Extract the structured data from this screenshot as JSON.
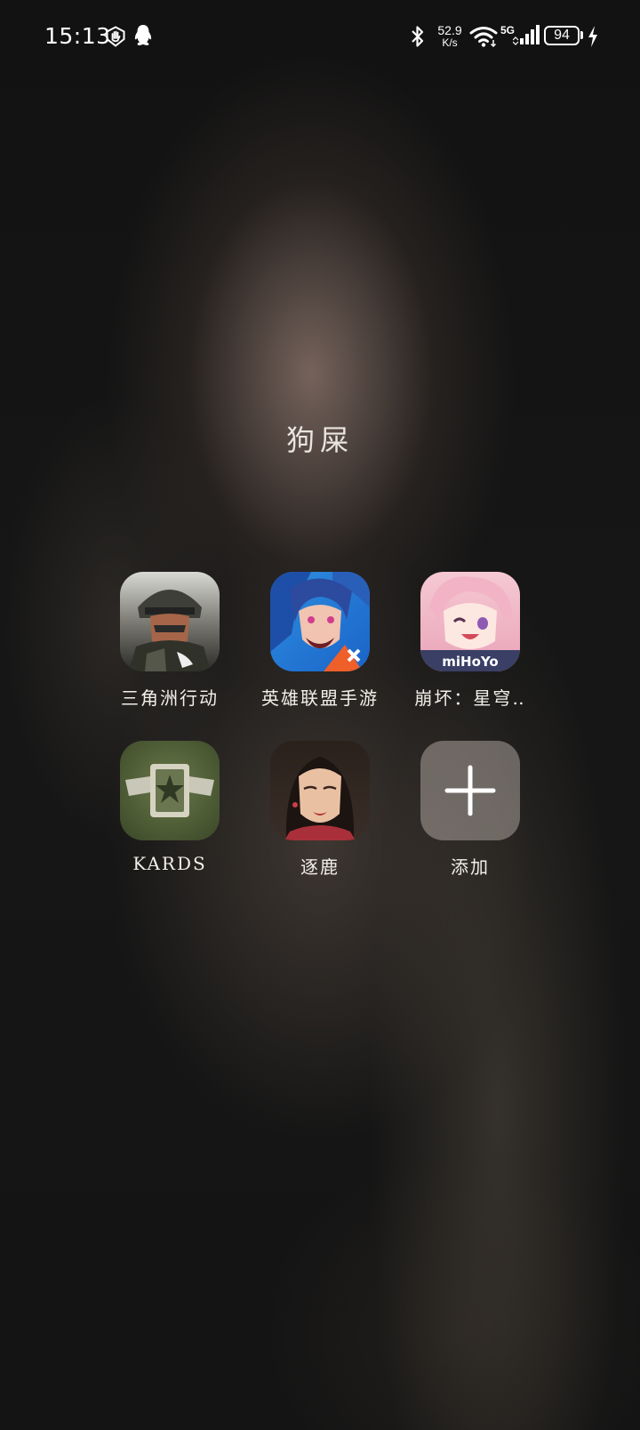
{
  "status_bar": {
    "time": "15:13",
    "net_speed_value": "52.9",
    "net_speed_unit": "K/s",
    "network_type": "5G",
    "battery_level": "94",
    "icons": [
      "shield-hand-icon",
      "qq-penguin-icon",
      "bluetooth-icon",
      "wifi-icon",
      "signal-bars-icon",
      "battery-icon",
      "charging-bolt-icon"
    ]
  },
  "folder": {
    "title": "狗屎",
    "apps": [
      {
        "label": "三角洲行动",
        "icon": "delta-force-app-icon"
      },
      {
        "label": "英雄联盟手游",
        "icon": "league-of-legends-wild-rift-app-icon"
      },
      {
        "label": "崩坏：星穹‥",
        "icon": "honkai-star-rail-app-icon"
      },
      {
        "label": "KARDS",
        "icon": "kards-app-icon"
      },
      {
        "label": "逐鹿",
        "icon": "zhulu-app-icon"
      },
      {
        "label": "添加",
        "icon": "add-plus-icon"
      }
    ],
    "icon_text": {
      "mihoyo": "miHoYo"
    }
  },
  "colors": {
    "text": "#f2efe9",
    "background": "#121212"
  }
}
